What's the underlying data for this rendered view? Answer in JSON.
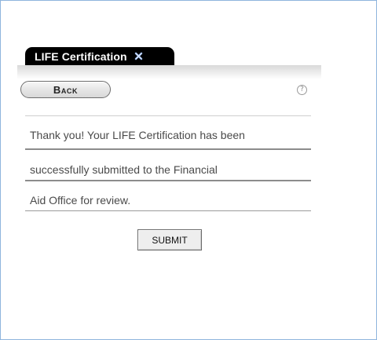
{
  "tab": {
    "label": "LIFE Certification",
    "close_icon": "close-x-icon"
  },
  "toolbar": {
    "back_label": "Back",
    "help_icon_glyph": "?",
    "help_icon": "help-circle-icon"
  },
  "message": {
    "lines": [
      "Thank you! Your LIFE Certification has been",
      "successfully submitted to the Financial",
      "Aid Office for review."
    ]
  },
  "actions": {
    "submit_label": "SUBMIT"
  },
  "colors": {
    "frame_border": "#8fb5dd",
    "tab_background": "#000000",
    "tab_text": "#ffffff",
    "close_icon": "#8fb0e6",
    "message_text": "#4a4a4a"
  }
}
